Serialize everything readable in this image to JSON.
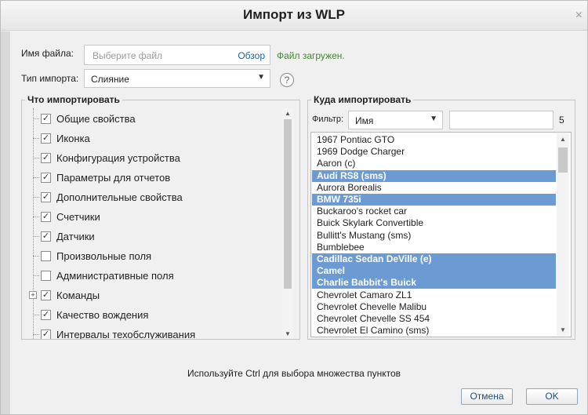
{
  "dialog": {
    "title": "Импорт из WLP",
    "close_glyph": "×"
  },
  "file": {
    "label": "Имя файла:",
    "placeholder": "Выберите файл",
    "browse_label": "Обзор",
    "status": "Файл загружен."
  },
  "import_type": {
    "label": "Тип импорта:",
    "value": "Слияние",
    "help_glyph": "?"
  },
  "what_to_import": {
    "title": "Что импортировать",
    "items": [
      {
        "label": "Общие свойства",
        "checked": true
      },
      {
        "label": "Иконка",
        "checked": true
      },
      {
        "label": "Конфигурация устройства",
        "checked": true
      },
      {
        "label": "Параметры для отчетов",
        "checked": true
      },
      {
        "label": "Дополнительные свойства",
        "checked": true
      },
      {
        "label": "Счетчики",
        "checked": true
      },
      {
        "label": "Датчики",
        "checked": true
      },
      {
        "label": "Произвольные поля",
        "checked": false
      },
      {
        "label": "Административные поля",
        "checked": false
      },
      {
        "label": "Команды",
        "checked": true,
        "expandable": true
      },
      {
        "label": "Качество вождения",
        "checked": true
      },
      {
        "label": "Интервалы техобслуживания",
        "checked": true
      }
    ]
  },
  "where_to_import": {
    "title": "Куда импортировать",
    "filter_label": "Фильтр:",
    "filter_field": "Имя",
    "filter_text": "",
    "count": "5",
    "units": [
      {
        "name": "1967 Pontiac GTO",
        "selected": false
      },
      {
        "name": "1969 Dodge Charger",
        "selected": false
      },
      {
        "name": "Aaron (c)",
        "selected": false
      },
      {
        "name": "Audi RS8 (sms)",
        "selected": true
      },
      {
        "name": "Aurora Borealis",
        "selected": false
      },
      {
        "name": "BMW 735i",
        "selected": true
      },
      {
        "name": "Buckaroo's rocket car",
        "selected": false
      },
      {
        "name": "Buick Skylark Convertible",
        "selected": false
      },
      {
        "name": "Bullitt's Mustang (sms)",
        "selected": false
      },
      {
        "name": "Bumblebee",
        "selected": false
      },
      {
        "name": "Cadillac Sedan DeVille (e)",
        "selected": true
      },
      {
        "name": "Camel",
        "selected": true
      },
      {
        "name": "Charlie Babbit's Buick",
        "selected": true
      },
      {
        "name": "Chevrolet Camaro ZL1",
        "selected": false
      },
      {
        "name": "Chevrolet Chevelle Malibu",
        "selected": false
      },
      {
        "name": "Chevrolet Chevelle SS 454",
        "selected": false
      },
      {
        "name": "Chevrolet El Camino (sms)",
        "selected": false
      }
    ]
  },
  "hint": "Используйте Ctrl для выбора множества пунктов",
  "buttons": {
    "cancel": "Отмена",
    "ok": "OK"
  },
  "glyphs": {
    "dropdown": "▼",
    "scroll_up": "▲",
    "scroll_down": "▼",
    "check": "✓",
    "expand": "+"
  }
}
